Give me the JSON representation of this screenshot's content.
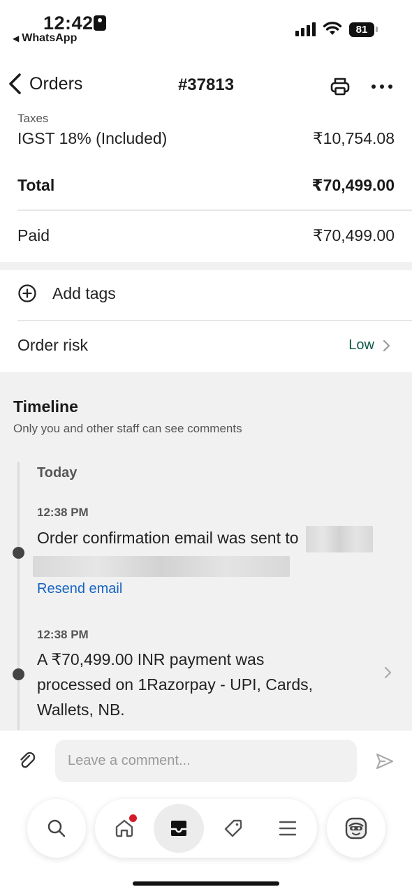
{
  "status_bar": {
    "time": "12:42",
    "back_app": "WhatsApp",
    "battery": "81"
  },
  "nav": {
    "back_label": "Orders",
    "title": "#37813"
  },
  "summary": {
    "taxes_label": "Taxes",
    "igst_label": "IGST 18% (Included)",
    "igst_value": "₹10,754.08",
    "total_label": "Total",
    "total_value": "₹70,499.00",
    "paid_label": "Paid",
    "paid_value": "₹70,499.00"
  },
  "tags": {
    "add_tags_label": "Add tags"
  },
  "risk": {
    "label": "Order risk",
    "value": "Low",
    "value_color": "#0f5a4a"
  },
  "timeline": {
    "title": "Timeline",
    "subtitle": "Only you and other staff can see comments",
    "day": "Today",
    "events": [
      {
        "time": "12:38 PM",
        "text": "Order confirmation email was sent to",
        "action": "Resend email"
      },
      {
        "time": "12:38 PM",
        "text": "A ₹70,499.00 INR payment was processed on 1Razorpay - UPI, Cards, Wallets, NB."
      }
    ]
  },
  "comment": {
    "placeholder": "Leave a comment..."
  },
  "tabbar": {
    "items": [
      "search-icon",
      "home-icon",
      "orders-inbox-icon",
      "tag-icon",
      "menu-icon",
      "avatar-icon"
    ],
    "active": "orders-inbox-icon",
    "notification_color": "#d21c2a"
  },
  "colors": {
    "link": "#1463c2",
    "band": "#f1f1f1"
  }
}
